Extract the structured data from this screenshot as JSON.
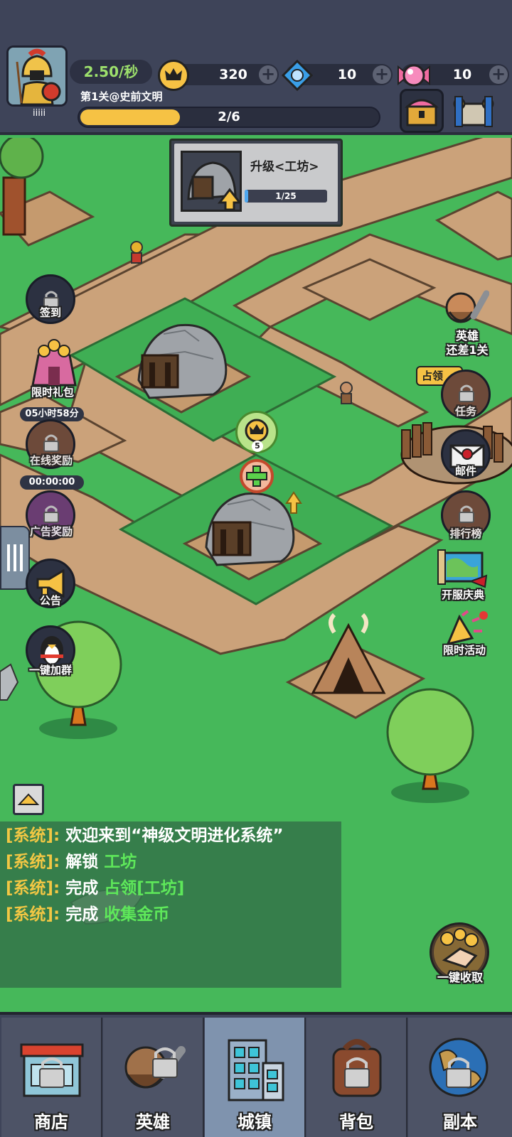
{
  "header": {
    "avatar_name": "iiiii",
    "income_rate": "2.50/秒",
    "gold": "320",
    "gems": "10",
    "candy": "10",
    "level_title": "第1关@史前文明",
    "level_progress_text": "2/6",
    "level_progress": 0.33
  },
  "upgrade": {
    "title": "升级<工坊>",
    "progress_text": "1/25",
    "progress": 0.04
  },
  "map": {
    "coin_badge": "5",
    "hero_prompt": "英雄\n还差1关",
    "occupy_label": "占领"
  },
  "left_buttons": [
    {
      "label": "签到",
      "locked": true
    },
    {
      "label": "限时礼包",
      "timer": "05小时58分",
      "locked": false
    },
    {
      "label": "在线奖励",
      "timer": "00:00:00",
      "locked": true
    },
    {
      "label": "广告奖励",
      "locked": true
    },
    {
      "label": "公告",
      "locked": false
    },
    {
      "label": "一键加群",
      "locked": false
    }
  ],
  "right_buttons": [
    {
      "label": "任务",
      "locked": true
    },
    {
      "label": "邮件",
      "locked": false
    },
    {
      "label": "排行榜",
      "locked": true
    },
    {
      "label": "开服庆典",
      "locked": false
    },
    {
      "label": "限时活动",
      "locked": false
    }
  ],
  "collect_all": "一键收取",
  "chat": [
    {
      "prefix": "[系统]:",
      "text": "欢迎来到“神级文明进化系统”",
      "highlight": ""
    },
    {
      "prefix": "[系统]:",
      "text": "解锁",
      "highlight": "工坊"
    },
    {
      "prefix": "[系统]:",
      "text": "完成",
      "highlight": "占领[工坊]"
    },
    {
      "prefix": "[系统]:",
      "text": "完成",
      "highlight": "收集金币"
    }
  ],
  "nav": [
    {
      "label": "商店",
      "locked": true,
      "active": false
    },
    {
      "label": "英雄",
      "locked": true,
      "active": false
    },
    {
      "label": "城镇",
      "locked": false,
      "active": true
    },
    {
      "label": "背包",
      "locked": true,
      "active": false
    },
    {
      "label": "副本",
      "locked": true,
      "active": false
    }
  ],
  "colors": {
    "grass": "#46b85a",
    "path": "#c9a177",
    "gold": "#f6c244",
    "highlight_green": "#5ee85a",
    "system_yellow": "#f2c744",
    "panel_dark": "#3e4459"
  }
}
